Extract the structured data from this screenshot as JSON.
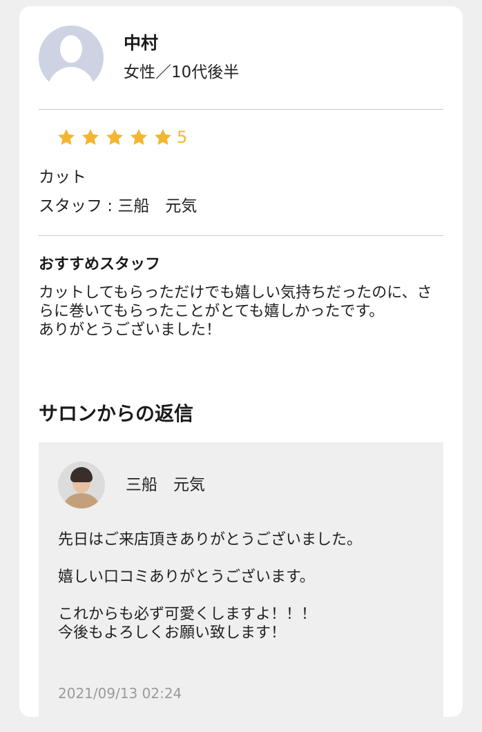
{
  "reviewer": {
    "name": "中村",
    "attributes": "女性／10代後半"
  },
  "rating": {
    "stars": 5,
    "value_text": "5",
    "star_color": "#f3b632"
  },
  "review": {
    "menu": "カット",
    "staff_line": "スタッフ : 三船　元気",
    "section_title": "おすすめスタッフ",
    "text": "カットしてもらっただけでも嬉しい気持ちだったのに、さらに巻いてもらったことがとても嬉しかったです。\nありがとうございました！"
  },
  "reply": {
    "heading": "サロンからの返信",
    "staff_name": "三船　元気",
    "text": "先日はご来店頂きありがとうございました。\n\n嬉しい口コミありがとうございます。\n\nこれからも必ず可愛くしますよ！！！\n今後もよろしくお願い致します！",
    "date": "2021/09/13 02:24"
  }
}
